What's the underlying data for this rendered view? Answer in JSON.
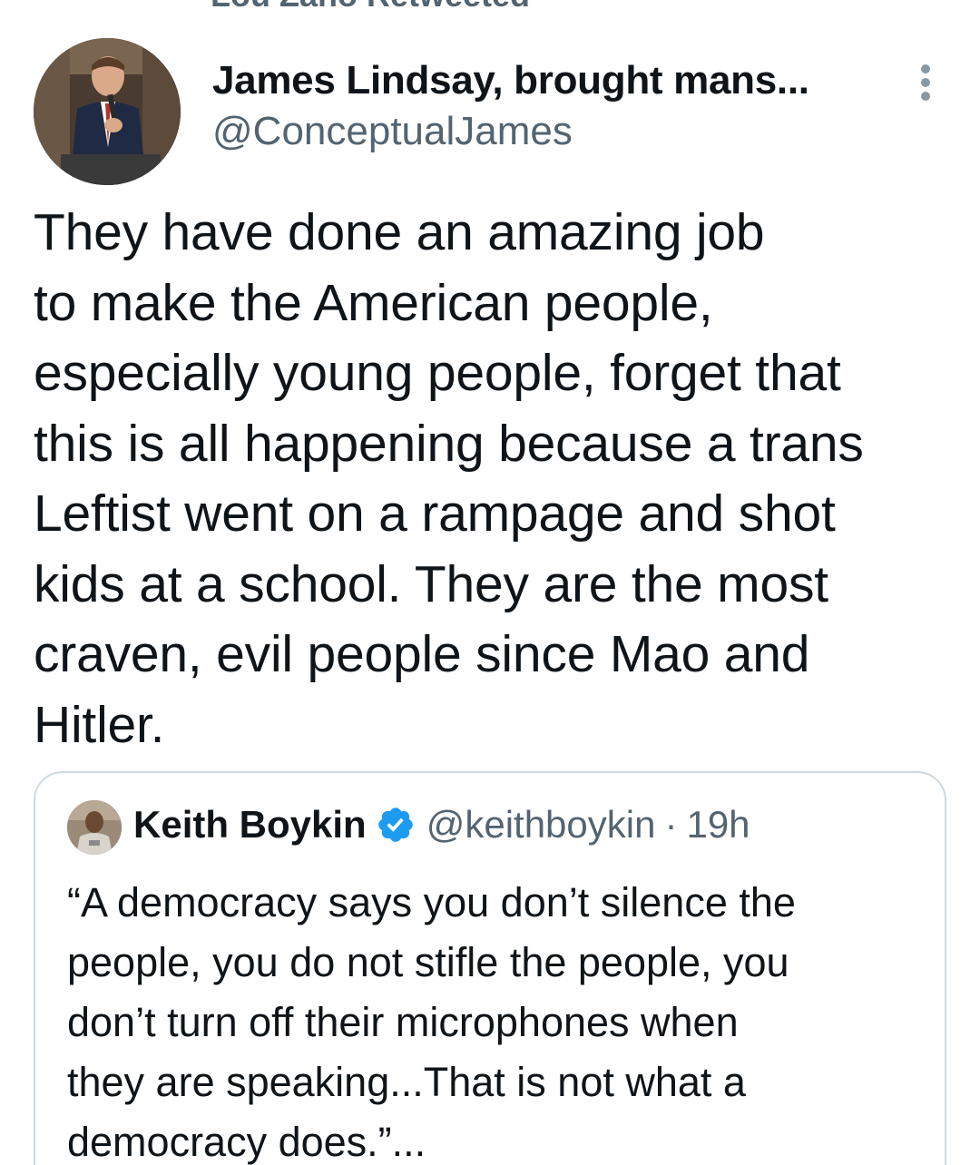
{
  "context": {
    "retweet_label": "Lou Zano Retweeted"
  },
  "tweet": {
    "author_name": "James Lindsay, brought mans...",
    "author_handle": "@ConceptualJames",
    "more_icon": "more-vertical-icon",
    "text_lines": [
      "They have done an amazing job",
      "to make the American people,",
      "especially young people, forget that",
      "this is all happening because a trans",
      "Leftist went on a rampage and shot",
      "kids at a school. They are the most",
      "craven, evil people since Mao and",
      "Hitler."
    ]
  },
  "quote": {
    "author_name": "Keith Boykin",
    "verified_icon": "verified-badge-icon",
    "author_handle": "@keithboykin",
    "separator": "·",
    "time": "19h",
    "text_lines": [
      "“A democracy says you don’t silence the",
      "people, you do not stifle the people, you",
      "don’t turn off their microphones when",
      "they are speaking...That is not what a",
      "democracy does.”..."
    ]
  },
  "colors": {
    "text_primary": "#0f1419",
    "text_secondary": "#536471",
    "verified_blue": "#1d9bf0",
    "card_border": "#cfd9de"
  }
}
